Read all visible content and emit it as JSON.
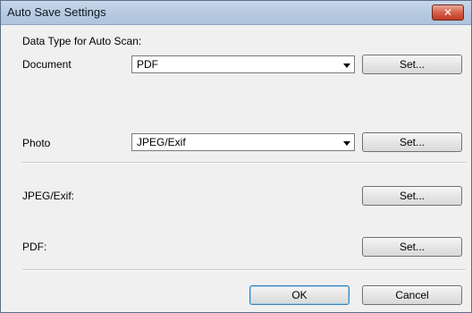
{
  "window": {
    "title": "Auto Save Settings",
    "close_glyph": "✕"
  },
  "section_header": "Data Type for Auto Scan:",
  "document": {
    "label": "Document",
    "value": "PDF",
    "set_label": "Set..."
  },
  "photo": {
    "label": "Photo",
    "value": "JPEG/Exif",
    "set_label": "Set..."
  },
  "jpeg": {
    "label": "JPEG/Exif:",
    "set_label": "Set..."
  },
  "pdf": {
    "label": "PDF:",
    "set_label": "Set..."
  },
  "footer": {
    "ok_label": "OK",
    "cancel_label": "Cancel"
  },
  "colors": {
    "titlebar": "#b9cbe2",
    "close_button": "#d5614a",
    "default_button_border": "#3c7fb1"
  }
}
